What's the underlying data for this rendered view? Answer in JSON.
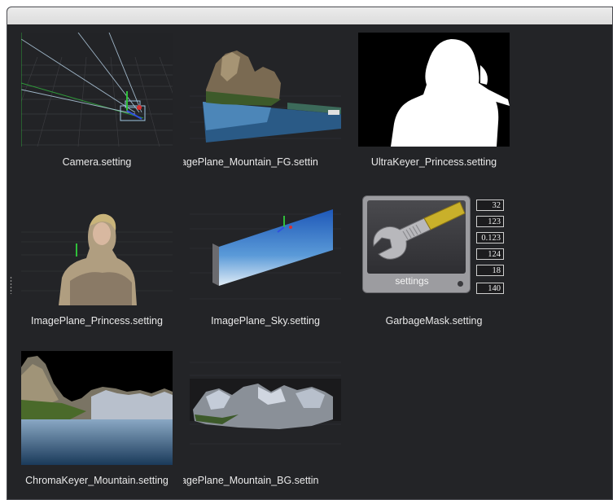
{
  "items": [
    {
      "name": "Camera.setting"
    },
    {
      "name": "ImagePlane_Mountain_FG.setting"
    },
    {
      "name": "UltraKeyer_Princess.setting"
    },
    {
      "name": "ImagePlane_Princess.setting"
    },
    {
      "name": "ImagePlane_Sky.setting"
    },
    {
      "name": "GarbageMask.setting"
    },
    {
      "name": "ChromaKeyer_Mountain.setting"
    },
    {
      "name": "ImagePlane_Mountain_BG.setting"
    }
  ],
  "captions": {
    "camera": "Camera.setting",
    "mountain_fg": "nagePlane_Mountain_FG.settin",
    "ultrakeyer": "UltraKeyer_Princess.setting",
    "princess": "ImagePlane_Princess.setting",
    "sky": "ImagePlane_Sky.setting",
    "garbagemask": "GarbageMask.setting",
    "chromakeyer": "ChromaKeyer_Mountain.setting",
    "mountain_bg": "nagePlane_Mountain_BG.settin"
  },
  "settings_icon": {
    "label": "settings",
    "numbers": [
      "32",
      "123",
      "0.123",
      "124",
      "18",
      "140"
    ]
  },
  "colors": {
    "background": "#232427",
    "caption_text": "#e9e9e9",
    "wrench_handle": "#c9b02a"
  },
  "icons": [
    "wrench-icon",
    "grip-handle-icon"
  ]
}
